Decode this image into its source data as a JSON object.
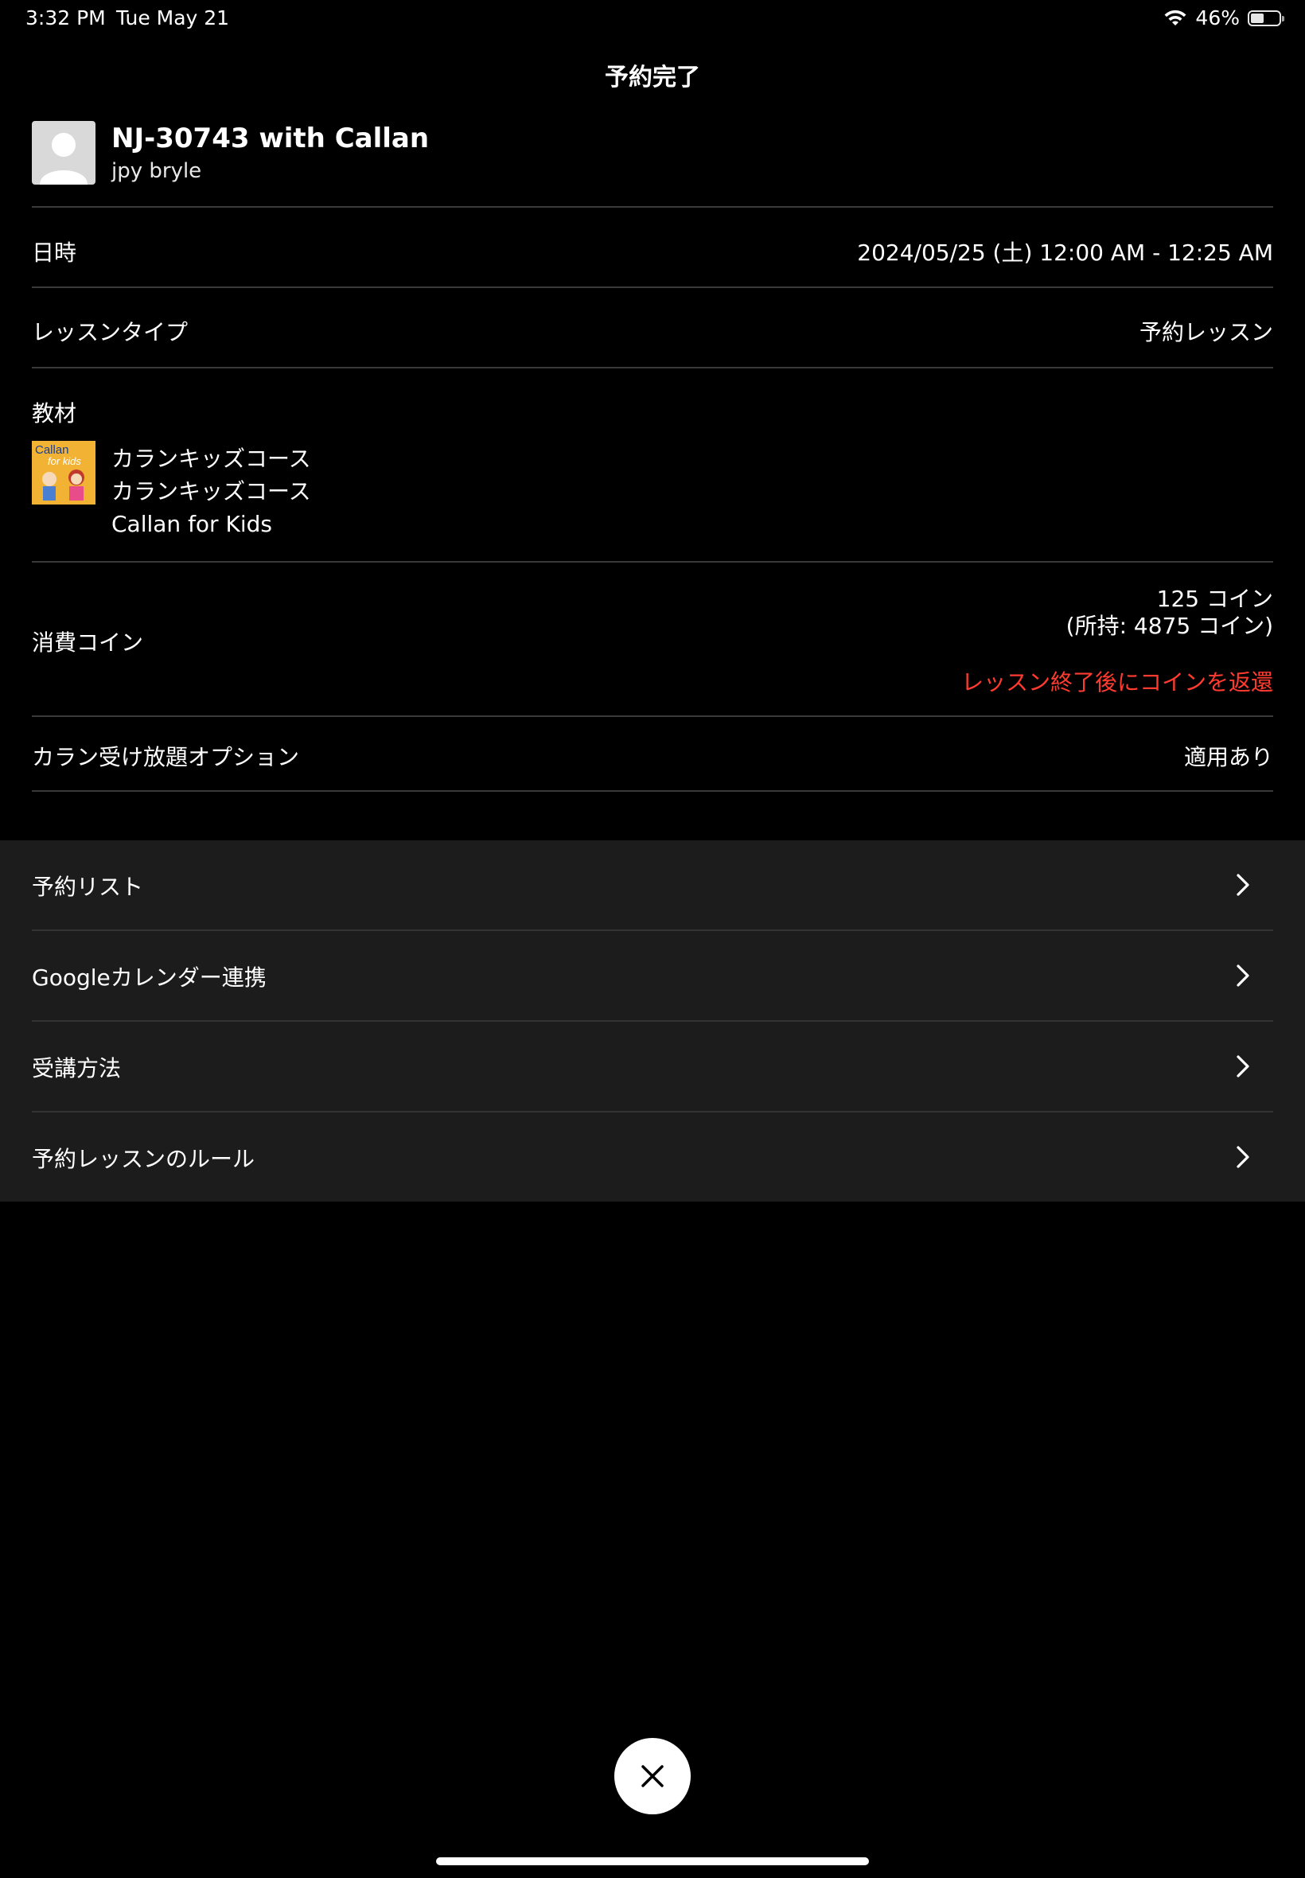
{
  "status_bar": {
    "time": "3:32 PM",
    "date": "Tue May 21",
    "battery": "46%",
    "battery_level": 0.46,
    "wifi_icon": "wifi-icon",
    "battery_icon": "battery-icon"
  },
  "title": "予約完了",
  "teacher": {
    "name": "NJ-30743 with Callan",
    "subtitle": "jpy bryle",
    "avatar_icon": "person-placeholder-icon"
  },
  "details": {
    "datetime_label": "日時",
    "datetime_value": "2024/05/25 (土) 12:00 AM - 12:25 AM",
    "lesson_type_label": "レッスンタイプ",
    "lesson_type_value": "予約レッスン",
    "material_label": "教材",
    "material_cover_text": [
      "Callan",
      "for kids"
    ],
    "material_lines": [
      "カランキッズコース",
      "カランキッズコース",
      "Callan for Kids"
    ],
    "coin_label": "消費コイン",
    "coin_value": "125 コイン",
    "coin_balance": "(所持: 4875 コイン)",
    "coin_note": "レッスン終了後にコインを返還",
    "callan_option_label": "カラン受け放題オプション",
    "callan_option_value": "適用あり"
  },
  "links": [
    {
      "label": "予約リスト",
      "icon": "chevron-right-icon"
    },
    {
      "label": "Googleカレンダー連携",
      "icon": "chevron-right-icon"
    },
    {
      "label": "受講方法",
      "icon": "chevron-right-icon"
    },
    {
      "label": "予約レッスンのルール",
      "icon": "chevron-right-icon"
    }
  ],
  "close_button": {
    "icon": "close-icon"
  },
  "colors": {
    "background": "#000000",
    "links_background": "#1c1c1c",
    "note_red": "#ff3b30",
    "text": "#ffffff"
  }
}
